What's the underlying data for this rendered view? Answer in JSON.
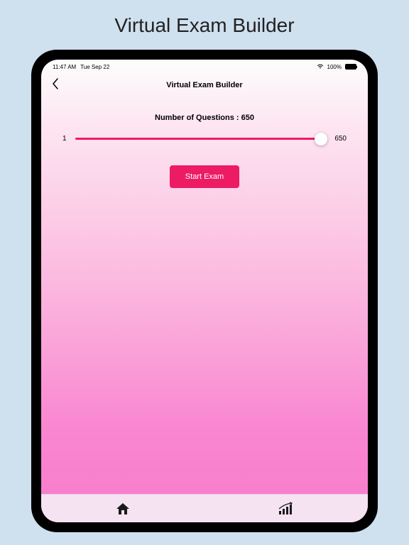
{
  "outer_title": "Virtual Exam Builder",
  "status": {
    "time": "11:47 AM",
    "date": "Tue Sep 22",
    "battery": "100%"
  },
  "nav": {
    "title": "Virtual Exam Builder"
  },
  "questions": {
    "label": "Number of Questions : 650",
    "min": "1",
    "max": "650",
    "value": 650
  },
  "start_label": "Start Exam",
  "colors": {
    "accent": "#ed1b64",
    "background_outer": "#cfe0ef"
  }
}
